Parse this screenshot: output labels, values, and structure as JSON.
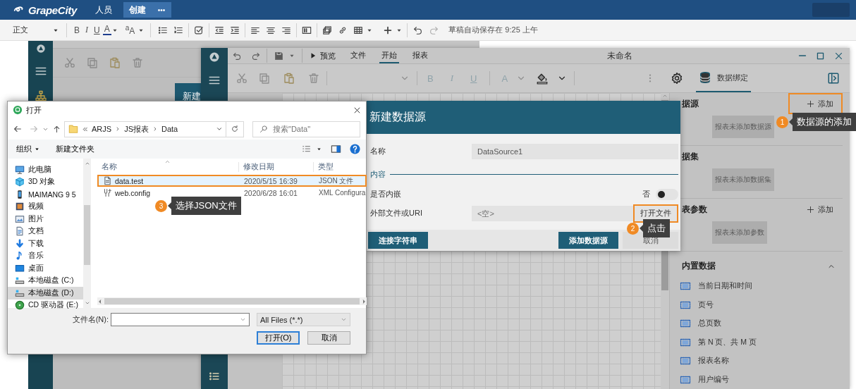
{
  "app_bar": {
    "logo": "GrapeCity",
    "nav": [
      {
        "label": "人员",
        "selected": false
      },
      {
        "label": "创建",
        "selected": true
      }
    ],
    "more": "•••"
  },
  "editor_toolbar": {
    "paragraph_style": "正文",
    "format": [
      "B",
      "I",
      "U"
    ],
    "font_color": "A",
    "font_size": "$^{a}$A",
    "autosave": "草稿自动保存在 9:25 上午"
  },
  "background_designer": {
    "tile": "新建"
  },
  "designer": {
    "preview": "预览",
    "menu_tabs": [
      {
        "label": "文件",
        "selected": false
      },
      {
        "label": "开始",
        "selected": true
      },
      {
        "label": "报表",
        "selected": false
      }
    ],
    "title": "未命名",
    "format": [
      "B",
      "I",
      "U"
    ],
    "font_color": "A",
    "panel_tab": {
      "label": "数据绑定",
      "selected": true
    },
    "sections": [
      {
        "title": "据源",
        "add": "添加",
        "highlighted": true,
        "empty": "报表未添加数据源"
      },
      {
        "title": "据集",
        "empty": "报表未添加数据集"
      },
      {
        "title": "表参数",
        "add": "添加",
        "highlighted": false,
        "empty": "报表未添加参数"
      }
    ],
    "builtin": {
      "title": "内置数据",
      "expanded": true,
      "items": [
        "当前日期和时间",
        "页号",
        "总页数",
        "第 N 页、共 M 页",
        "报表名称",
        "用户编号"
      ]
    }
  },
  "datasource_dialog": {
    "title": "新建数据源",
    "name_label": "名称",
    "name_value": "DataSource1",
    "section": "内容",
    "embed_label": "是否内嵌",
    "embed_state": "否",
    "embed_on": false,
    "uri_label": "外部文件或URI",
    "uri_placeholder": "<空>",
    "open_file": {
      "label": "打开文件",
      "highlighted": true
    },
    "buttons": [
      {
        "label": "连接字符串",
        "kind": "primary"
      },
      {
        "label": "添加数据源",
        "kind": "primary"
      },
      {
        "label": "取消",
        "kind": "secondary"
      }
    ]
  },
  "file_dialog": {
    "title": "打开",
    "path": [
      "ARJS",
      "JS报表",
      "Data"
    ],
    "search_placeholder": "搜索\"Data\"",
    "organize": "组织",
    "new_folder": "新建文件夹",
    "nav": [
      {
        "label": "此电脑",
        "kind": "pc",
        "selected": false
      },
      {
        "label": "3D 对象",
        "kind": "cube",
        "selected": false
      },
      {
        "label": "MAIMANG 9 5",
        "kind": "phone",
        "selected": false
      },
      {
        "label": "视频",
        "kind": "video",
        "selected": false
      },
      {
        "label": "图片",
        "kind": "picture",
        "selected": false
      },
      {
        "label": "文档",
        "kind": "document",
        "selected": false
      },
      {
        "label": "下载",
        "kind": "download",
        "selected": false
      },
      {
        "label": "音乐",
        "kind": "music",
        "selected": false
      },
      {
        "label": "桌面",
        "kind": "desktop",
        "selected": false
      },
      {
        "label": "本地磁盘 (C:)",
        "kind": "drive",
        "selected": false
      },
      {
        "label": "本地磁盘 (D:)",
        "kind": "drive",
        "selected": true
      },
      {
        "label": "CD 驱动器 (E:)",
        "kind": "cd",
        "selected": false
      }
    ],
    "columns": [
      "名称",
      "修改日期",
      "类型"
    ],
    "files": [
      {
        "name": "data.test",
        "kind": "file",
        "modified": "2020/5/15 16:39",
        "type": "JSON 文件",
        "selected": true
      },
      {
        "name": "web.config",
        "kind": "config",
        "modified": "2020/6/28 16:01",
        "type": "XML Configura",
        "selected": false
      }
    ],
    "filename_label": "文件名(N):",
    "filter": "All Files (*.*)",
    "buttons": [
      {
        "label": "打开(O)",
        "kind": "default"
      },
      {
        "label": "取消",
        "kind": "normal"
      }
    ]
  },
  "callouts": [
    {
      "number": "1",
      "text": "数据源的添加"
    },
    {
      "number": "2",
      "text": "点击"
    },
    {
      "number": "3",
      "text": "选择JSON文件"
    }
  ]
}
